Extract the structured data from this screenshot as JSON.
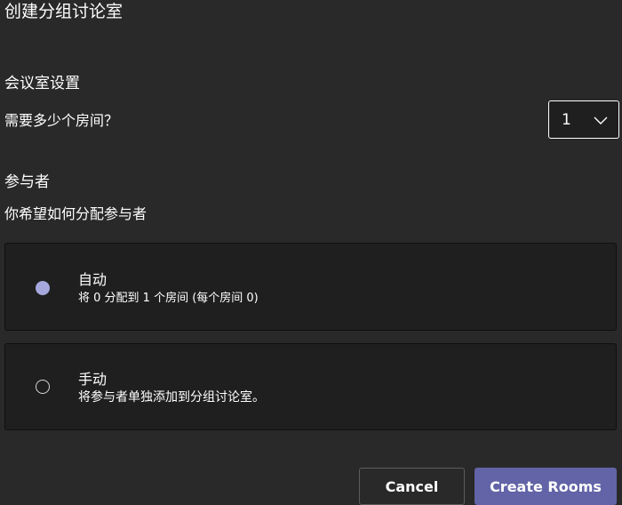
{
  "dialog": {
    "title": "创建分组讨论室"
  },
  "room_settings": {
    "heading": "会议室设置",
    "question": "需要多少个房间？",
    "rooms_count": "1"
  },
  "participants": {
    "heading": "参与者",
    "prompt": "你希望如何分配参与者",
    "options": [
      {
        "title": "自动",
        "description": "将 0 分配到 1 个房间 (每个房间 0)",
        "selected": true
      },
      {
        "title": "手动",
        "description": "将参与者单独添加到分组讨论室。",
        "selected": false
      }
    ]
  },
  "actions": {
    "cancel_label": "Cancel",
    "create_label": "Create Rooms"
  },
  "colors": {
    "background": "#292929",
    "card": "#1f1f1f",
    "accent": "#6264a7",
    "radio_selected": "#a6a7dc"
  }
}
